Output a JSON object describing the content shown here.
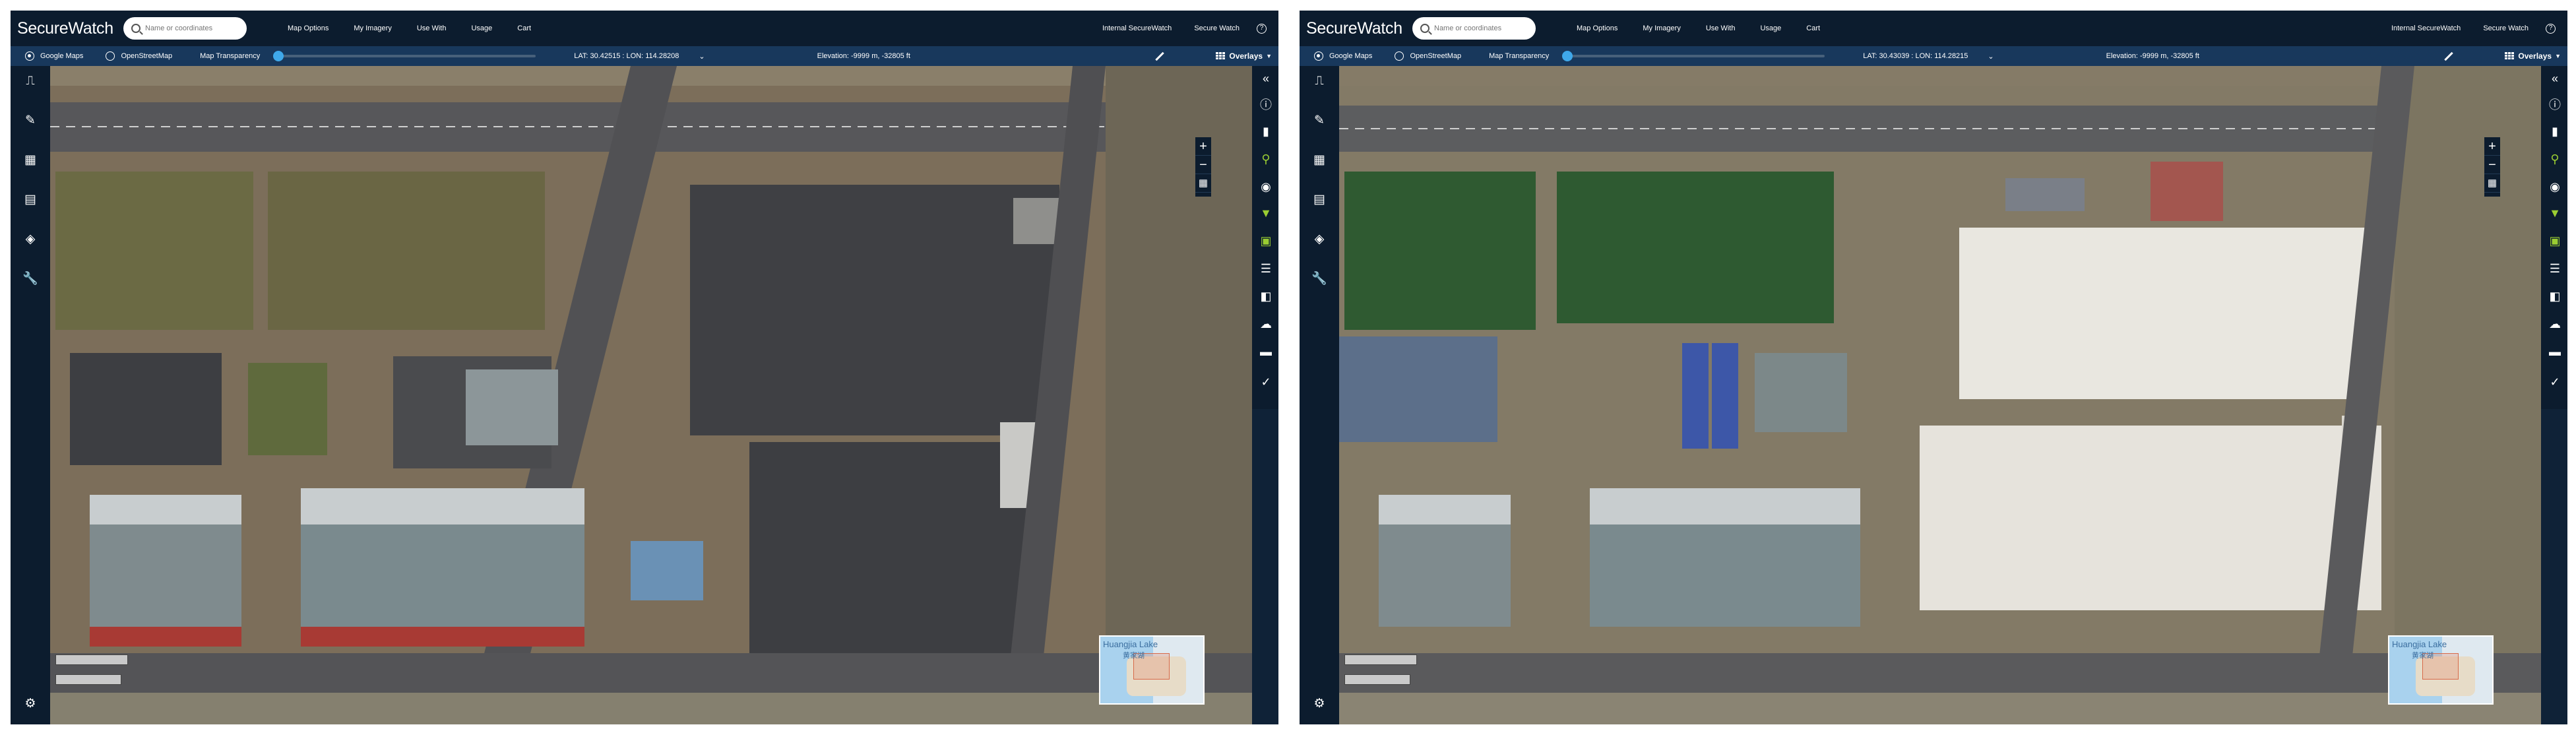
{
  "app": {
    "title": "SecureWatch"
  },
  "search": {
    "placeholder": "Name or coordinates"
  },
  "nav": {
    "map_options": "Map Options",
    "my_imagery": "My Imagery",
    "use_with": "Use With",
    "usage": "Usage",
    "cart": "Cart",
    "internal": "Internal SecureWatch",
    "secure_watch": "Secure Watch",
    "help": "?"
  },
  "basemap": {
    "google": "Google Maps",
    "osm": "OpenStreetMap",
    "transparency_label": "Map Transparency",
    "transparency_value": 0.0
  },
  "panels": [
    {
      "coords": "LAT: 30.42515 : LON: 114.28208",
      "elevation": "Elevation: -9999 m, -32805 ft"
    },
    {
      "coords": "LAT: 30.43039 : LON: 114.28215",
      "elevation": "Elevation: -9999 m, -32805 ft"
    }
  ],
  "overlays_label": "Overlays",
  "minimap": {
    "label": "Huangjia Lake",
    "sublabel": "黄家湖"
  },
  "colors": {
    "topbar": "#0c1c2e",
    "subbar": "#18385c",
    "accent": "#3fa8ea",
    "green_tool": "#9acd32"
  }
}
